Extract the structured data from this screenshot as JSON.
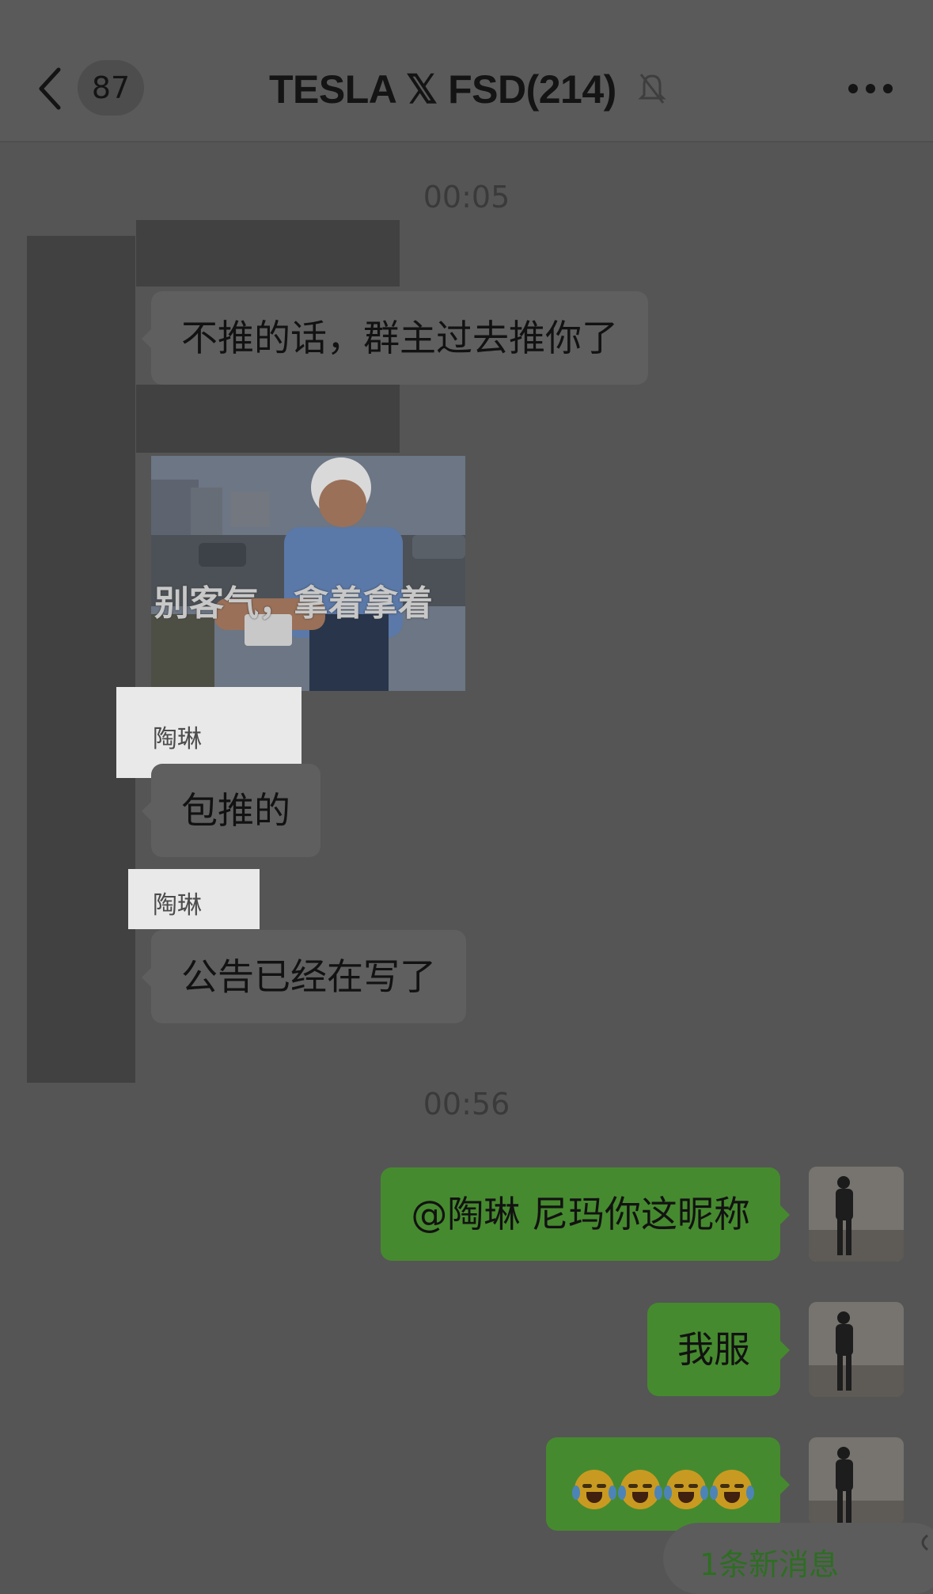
{
  "header": {
    "unread_count": "87",
    "title": "TESLA 𝕏 FSD(214)",
    "mute_icon": "bell-slash-icon",
    "more_icon": "ellipsis-icon",
    "back_icon": "chevron-left-icon"
  },
  "messages": {
    "time_1": "00:05",
    "msg_1": "不推的话，群主过去推你了",
    "sticker_caption": "别客气，拿着拿着",
    "sender_2": "陶琳",
    "msg_2": "包推的",
    "sender_3": "陶琳",
    "msg_3": "公告已经在写了",
    "time_2": "00:56",
    "out_1": "@陶琳 尼玛你这昵称",
    "out_2": "我服",
    "out_3_emoji": "crying-laughing-face ×4"
  },
  "new_messages_banner": "1条新消息",
  "colors": {
    "background": "#555555",
    "incoming_bubble": "#5f5f5f",
    "outgoing_bubble": "#468a2f",
    "redaction": "#414141"
  }
}
